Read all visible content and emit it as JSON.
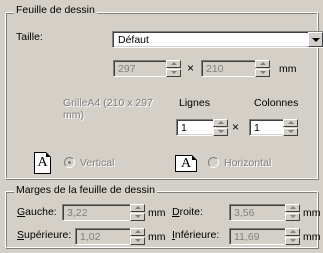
{
  "sheet": {
    "title": "Feuille de dessin",
    "size_label": "Taille:",
    "size_value": "Défaut",
    "width": "297",
    "height": "210",
    "times": "×",
    "unit": "mm",
    "grid_info": "GrilleA4 (210 x 297\nmm)",
    "rows_label": "Lignes",
    "cols_label": "Colonnes",
    "rows_value": "1",
    "cols_value": "1",
    "portrait_label": "Vertical",
    "landscape_label": "Horizontal",
    "page_glyph": "A"
  },
  "margins": {
    "title": "Marges de la feuille de dessin",
    "left_label_key": "G",
    "left_label_rest": "auche:",
    "left_value": "3,22",
    "right_label_key": "D",
    "right_label_rest": "roite:",
    "right_value": "3,56",
    "top_label_key": "S",
    "top_label_rest": "upérieure:",
    "top_value": "1,02",
    "bottom_label_key": "I",
    "bottom_label_rest": "nférieure:",
    "bottom_value": "11,69",
    "unit": "mm"
  }
}
